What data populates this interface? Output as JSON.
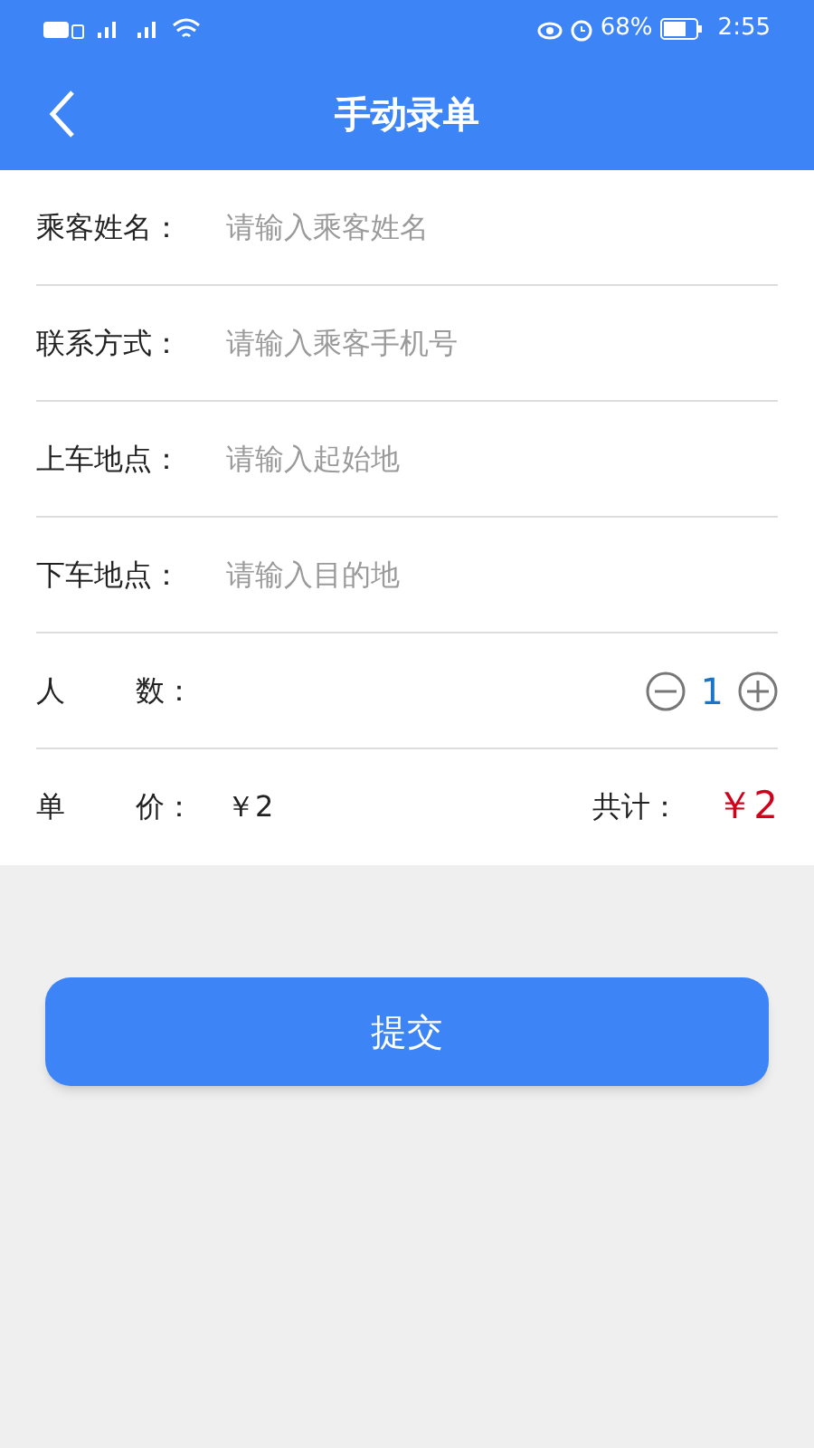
{
  "status_bar": {
    "battery": "68%",
    "time": "2:55"
  },
  "header": {
    "title": "手动录单"
  },
  "fields": [
    {
      "label": "乘客姓名：",
      "placeholder": "请输入乘客姓名"
    },
    {
      "label": "联系方式：",
      "placeholder": "请输入乘客手机号"
    },
    {
      "label": "上车地点：",
      "placeholder": "请输入起始地"
    },
    {
      "label": "下车地点：",
      "placeholder": "请输入目的地"
    }
  ],
  "count": {
    "label_parts": [
      "人",
      "数："
    ],
    "value": "1"
  },
  "price": {
    "label_parts": [
      "单",
      "价："
    ],
    "value": "￥2",
    "total_label": "共计：",
    "total": "￥2"
  },
  "submit": "提交"
}
